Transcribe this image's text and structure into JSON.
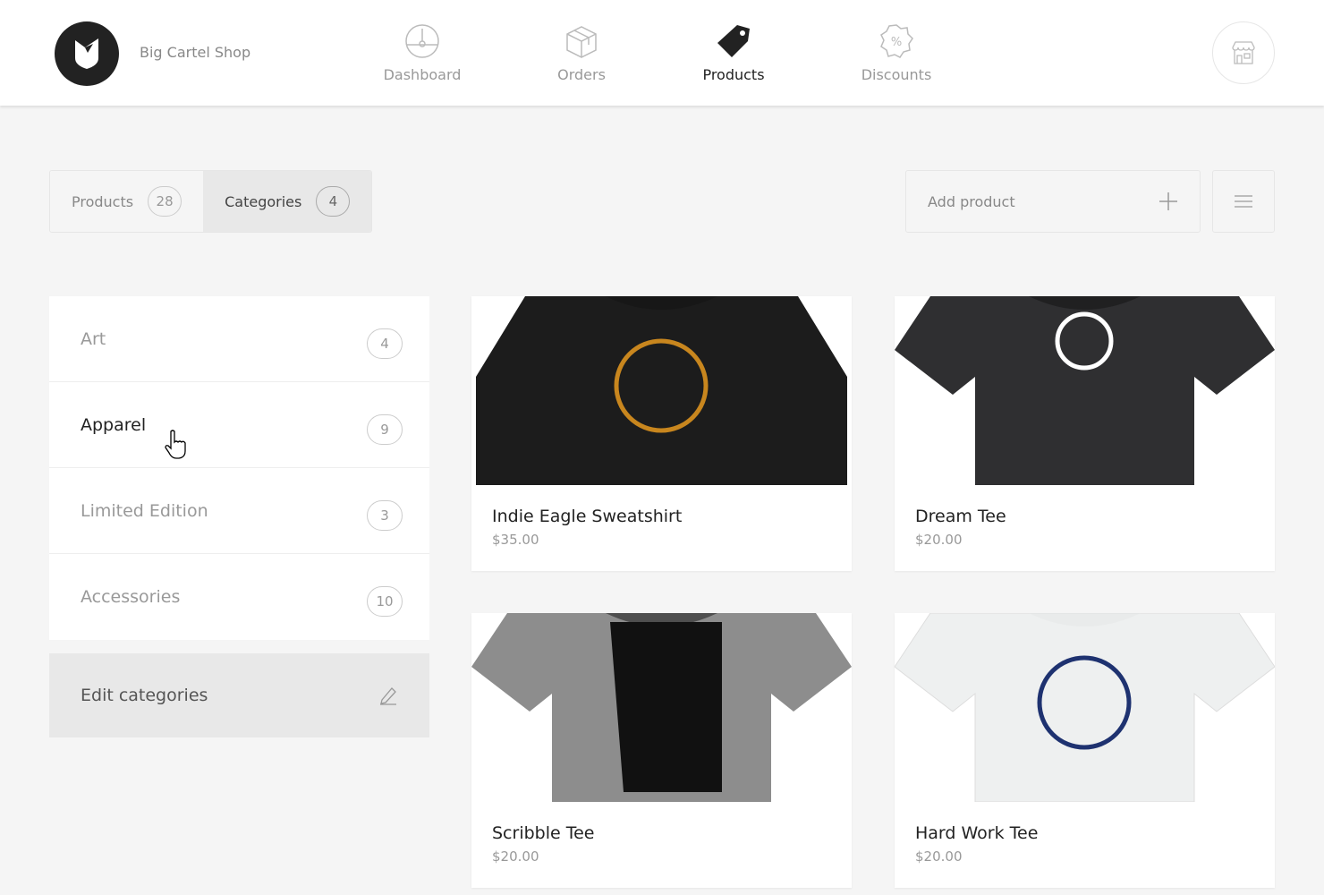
{
  "header": {
    "shop_name": "Big Cartel Shop",
    "nav": [
      {
        "label": "Dashboard",
        "icon": "dashboard-gauge-icon"
      },
      {
        "label": "Orders",
        "icon": "box-icon"
      },
      {
        "label": "Products",
        "icon": "tag-icon",
        "active": true
      },
      {
        "label": "Discounts",
        "icon": "discount-badge-icon"
      }
    ],
    "store_icon": "storefront-icon"
  },
  "tabs": [
    {
      "label": "Products",
      "count": "28"
    },
    {
      "label": "Categories",
      "count": "4",
      "active": true
    }
  ],
  "toolbar": {
    "add_product": "Add product",
    "menu_icon": "hamburger-icon"
  },
  "categories": [
    {
      "label": "Art",
      "count": "4"
    },
    {
      "label": "Apparel",
      "count": "9",
      "active": true
    },
    {
      "label": "Limited Edition",
      "count": "3"
    },
    {
      "label": "Accessories",
      "count": "10"
    }
  ],
  "edit_categories": "Edit categories",
  "products": [
    {
      "name": "Indie Eagle Sweatshirt",
      "price": "$35.00",
      "shirt_color": "#1c1c1c",
      "art_color": "#c8861e"
    },
    {
      "name": "Dream Tee",
      "price": "$20.00",
      "shirt_color": "#2f2f31",
      "art_color": "#ffffff"
    },
    {
      "name": "Scribble Tee",
      "price": "$20.00",
      "shirt_color": "#8d8d8d",
      "art_color": "#111111"
    },
    {
      "name": "Hard Work Tee",
      "price": "$20.00",
      "shirt_color": "#eef0f0",
      "art_color": "#1e3270"
    }
  ]
}
